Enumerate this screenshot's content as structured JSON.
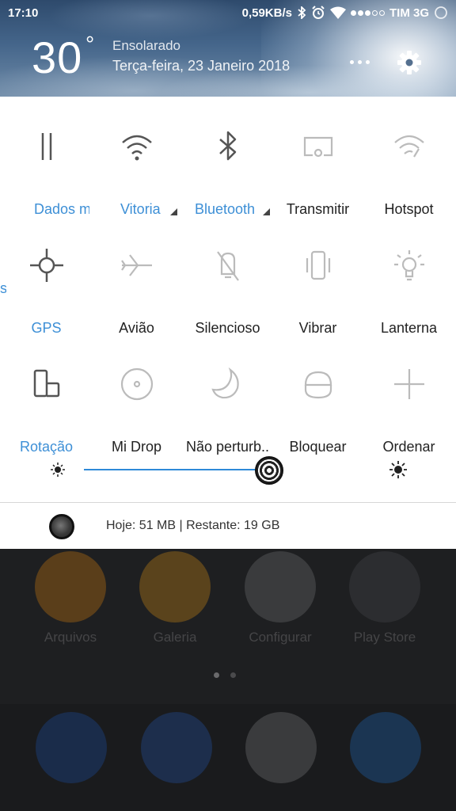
{
  "status_bar": {
    "time": "17:10",
    "speed": "0,59KB/s",
    "carrier": "TIM 3G",
    "signal_bars_filled": 3,
    "signal_bars_total": 5
  },
  "weather": {
    "temperature": "30",
    "degree_symbol": "°",
    "condition": "Ensolarado",
    "date": "Terça-feira, 23 Janeiro 2018"
  },
  "toggles": [
    {
      "label": "Dados m",
      "icon": "pause-bars-icon",
      "active": true
    },
    {
      "label": "Vitoria",
      "icon": "wifi-icon",
      "active": true
    },
    {
      "label": "Bluetooth",
      "icon": "bluetooth-icon",
      "active": true
    },
    {
      "label": "Transmitir",
      "icon": "cast-screen-icon",
      "active": false
    },
    {
      "label": "Hotspot",
      "icon": "hotspot-icon",
      "active": false
    },
    {
      "label": "GPS",
      "icon": "gps-crosshair-icon",
      "active": true
    },
    {
      "label": "Avião",
      "icon": "airplane-icon",
      "active": false
    },
    {
      "label": "Silencioso",
      "icon": "bell-off-icon",
      "active": false
    },
    {
      "label": "Vibrar",
      "icon": "vibrate-icon",
      "active": false
    },
    {
      "label": "Lanterna",
      "icon": "flashlight-icon",
      "active": false
    },
    {
      "label": "Rotação",
      "icon": "rotation-lock-icon",
      "active": true
    },
    {
      "label": "Mi Drop",
      "icon": "mi-drop-icon",
      "active": false
    },
    {
      "label": "Não perturb..",
      "icon": "moon-icon",
      "active": false
    },
    {
      "label": "Bloquear",
      "icon": "lock-icon",
      "active": false
    },
    {
      "label": "Ordenar",
      "icon": "plus-icon",
      "active": false
    }
  ],
  "brightness": {
    "level": 0.78
  },
  "data_usage": {
    "text": "Hoje: 51 MB | Restante: 19 GB"
  },
  "home": {
    "apps": [
      {
        "label": "Arquivos",
        "color": "#5a3e1a"
      },
      {
        "label": "Galeria",
        "color": "#5a431c"
      },
      {
        "label": "Configurar",
        "color": "#3a3b3d"
      },
      {
        "label": "Play Store",
        "color": "#2c2d30"
      }
    ],
    "dock_colors": [
      "#1a2c4a",
      "#1d2e4c",
      "#3a3b3d",
      "#1b3552"
    ]
  },
  "colors": {
    "accent": "#3d8fd6",
    "slider": "#2e8ad8"
  }
}
